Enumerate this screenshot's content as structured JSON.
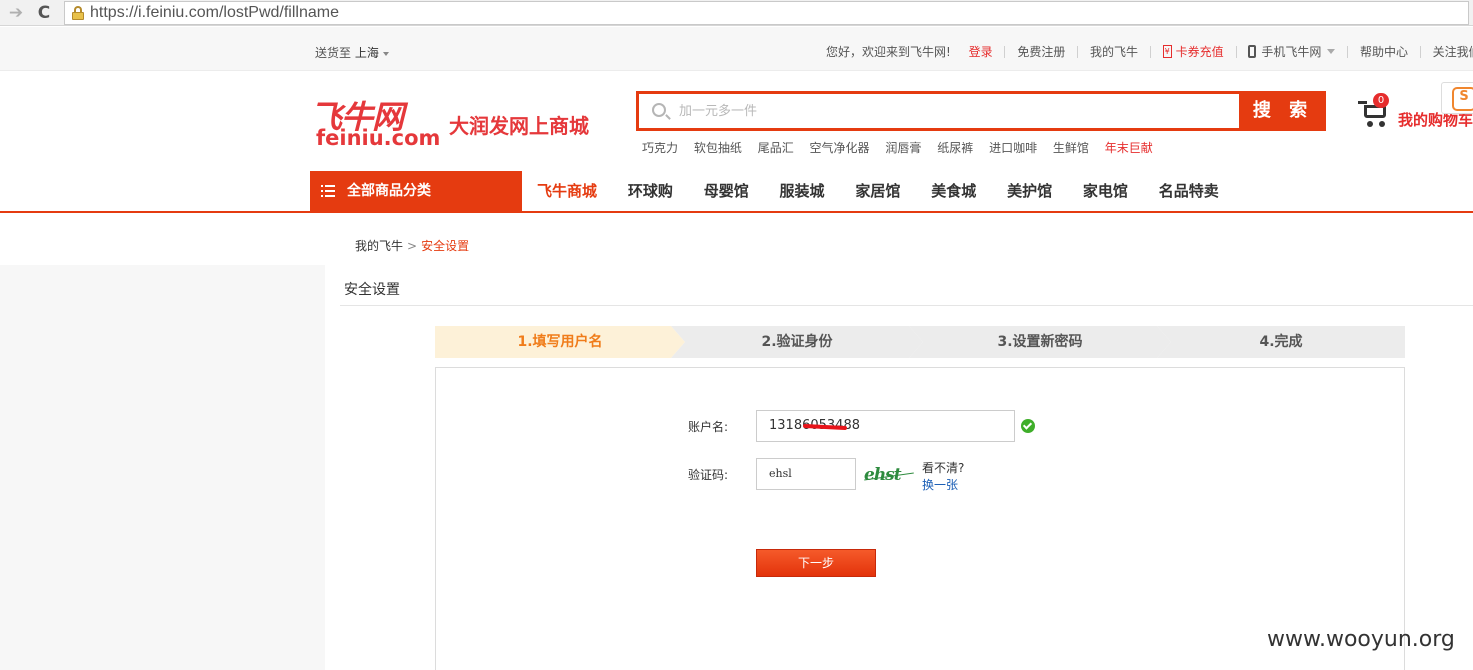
{
  "browser": {
    "url": "https://i.feiniu.com/lostPwd/fillname",
    "back_glyph": "➔",
    "reload_glyph": "C"
  },
  "top_bar": {
    "ship_to_label": "送货至",
    "city": "上海",
    "welcome": "您好，欢迎来到飞牛网!",
    "login": "登录",
    "register": "免费注册",
    "my_feiniu": "我的飞牛",
    "card_icon_glyph": "¥",
    "card_recharge": "卡券充值",
    "mobile": "手机飞牛网",
    "help": "帮助中心",
    "follow": "关注我们:"
  },
  "header": {
    "logo_text": "飞牛网",
    "logo_domain": "feiniu.com",
    "slogan": "大润发网上商城",
    "search_placeholder": "加一元多一件",
    "search_button": "搜 索",
    "hot_words": [
      "巧克力",
      "软包抽纸",
      "尾品汇",
      "空气净化器",
      "润唇膏",
      "纸尿裤",
      "进口咖啡",
      "生鲜馆"
    ],
    "hot_highlight": "年末巨献",
    "cart_count": "0",
    "cart_label": "我的购物车"
  },
  "nav": {
    "all_categories": "全部商品分类",
    "items": [
      "飞牛商城",
      "环球购",
      "母婴馆",
      "服装城",
      "家居馆",
      "美食城",
      "美护馆",
      "家电馆",
      "名品特卖"
    ]
  },
  "breadcrumb": {
    "root": "我的飞牛",
    "separator": ">",
    "current": "安全设置"
  },
  "panel": {
    "title": "安全设置"
  },
  "steps": [
    {
      "label": "1.填写用户名",
      "state": "active"
    },
    {
      "label": "2.验证身份",
      "state": "pending"
    },
    {
      "label": "3.设置新密码",
      "state": "pending"
    },
    {
      "label": "4.完成",
      "state": "pending"
    }
  ],
  "form": {
    "account_label": "账户名:",
    "account_value": "13186053488",
    "captcha_label": "验证码:",
    "captcha_value": "ehsl",
    "captcha_image_text": "ehst",
    "cant_see": "看不清?",
    "refresh": "换一张",
    "next_button": "下一步"
  },
  "watermark": "www.wooyun.org",
  "colors": {
    "brand_red": "#e53b10",
    "active_step_bg": "#fdf1d8",
    "active_step_text": "#f07c1a",
    "pending_step_bg": "#ececec",
    "link_blue": "#1a5eb5",
    "success_green": "#3fae2a"
  }
}
